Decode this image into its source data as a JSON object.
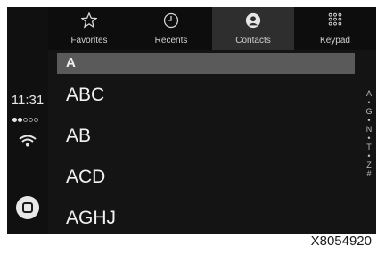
{
  "status": {
    "time": "11:31"
  },
  "tabs": [
    {
      "label": "Favorites",
      "icon": "star-icon"
    },
    {
      "label": "Recents",
      "icon": "clock-icon"
    },
    {
      "label": "Contacts",
      "icon": "person-icon",
      "active": true
    },
    {
      "label": "Keypad",
      "icon": "keypad-icon"
    }
  ],
  "section": {
    "letter": "A"
  },
  "contacts": [
    "ABC",
    "AB",
    "ACD",
    "AGHJ"
  ],
  "alpha_index": [
    "A",
    "•",
    "G",
    "•",
    "N",
    "•",
    "T",
    "•",
    "Z",
    "#"
  ],
  "caption": "X8054920",
  "colors": {
    "background": "#0e0e0e",
    "active_tab": "#2e2e2e",
    "section_header": "#5a5a5a",
    "text": "#f2f2f2"
  }
}
